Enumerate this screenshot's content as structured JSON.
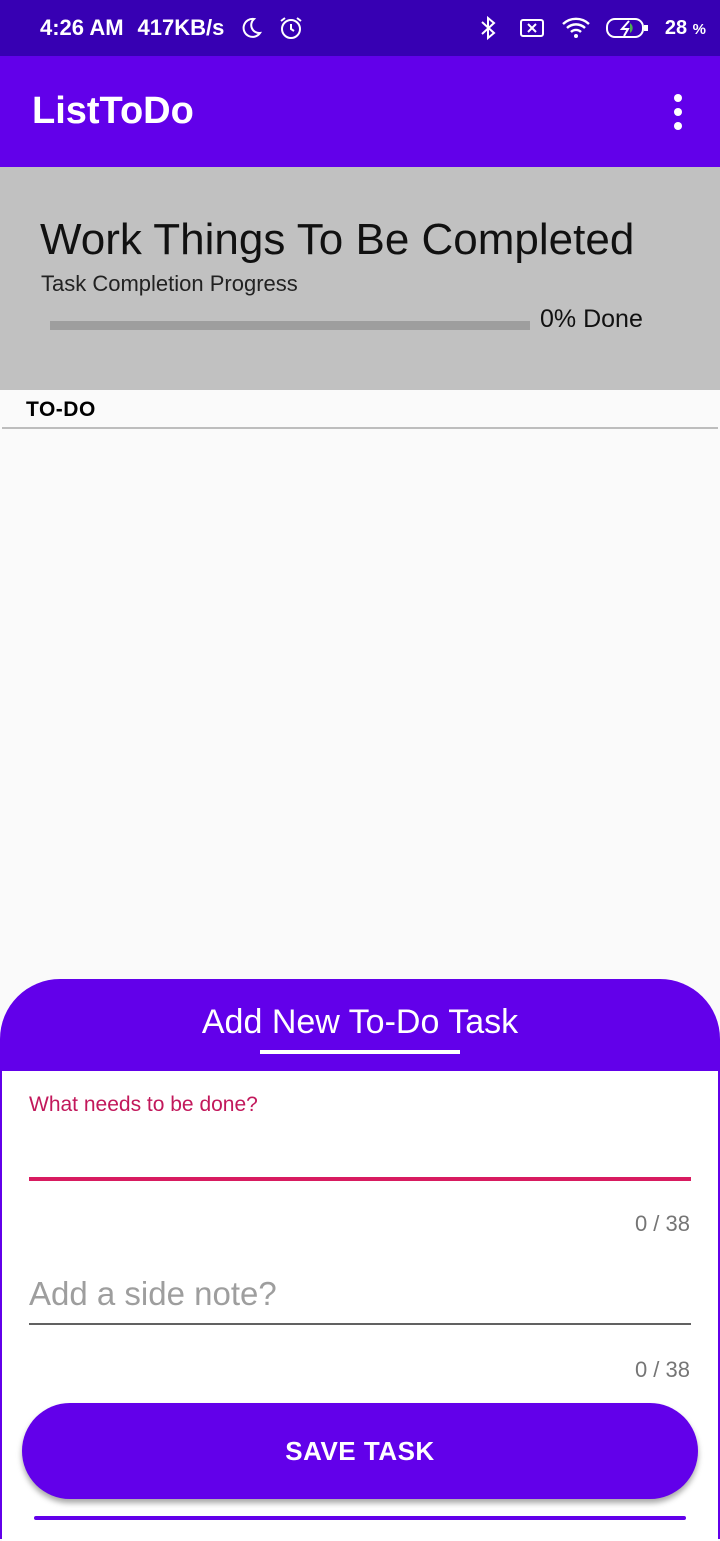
{
  "status_bar": {
    "time": "4:26 AM",
    "net_speed": "417KB/s",
    "battery": "28",
    "battery_unit": "%"
  },
  "app_bar": {
    "title": "ListToDo"
  },
  "header": {
    "title": "Work Things To Be Completed",
    "subtitle": "Task Completion Progress",
    "progress_label": "0% Done",
    "progress_fraction": 0
  },
  "tabs": {
    "todo_label": "TO-DO"
  },
  "sheet": {
    "title": "Add New To-Do Task",
    "task_field": {
      "label": "What needs to be done?",
      "value": "",
      "counter": "0 / 38"
    },
    "note_field": {
      "placeholder": "Add a side note?",
      "value": "",
      "counter": "0 / 38"
    },
    "save_label": "SAVE TASK"
  },
  "colors": {
    "status_bar": "#3700b3",
    "primary": "#6200ea",
    "accent_error": "#d81b60",
    "header_bg": "#c1c1c1"
  },
  "icons": [
    "moon-icon",
    "alarm-icon",
    "bluetooth-icon",
    "sim-x-icon",
    "wifi-icon",
    "battery-charging-icon",
    "overflow-menu-icon"
  ]
}
